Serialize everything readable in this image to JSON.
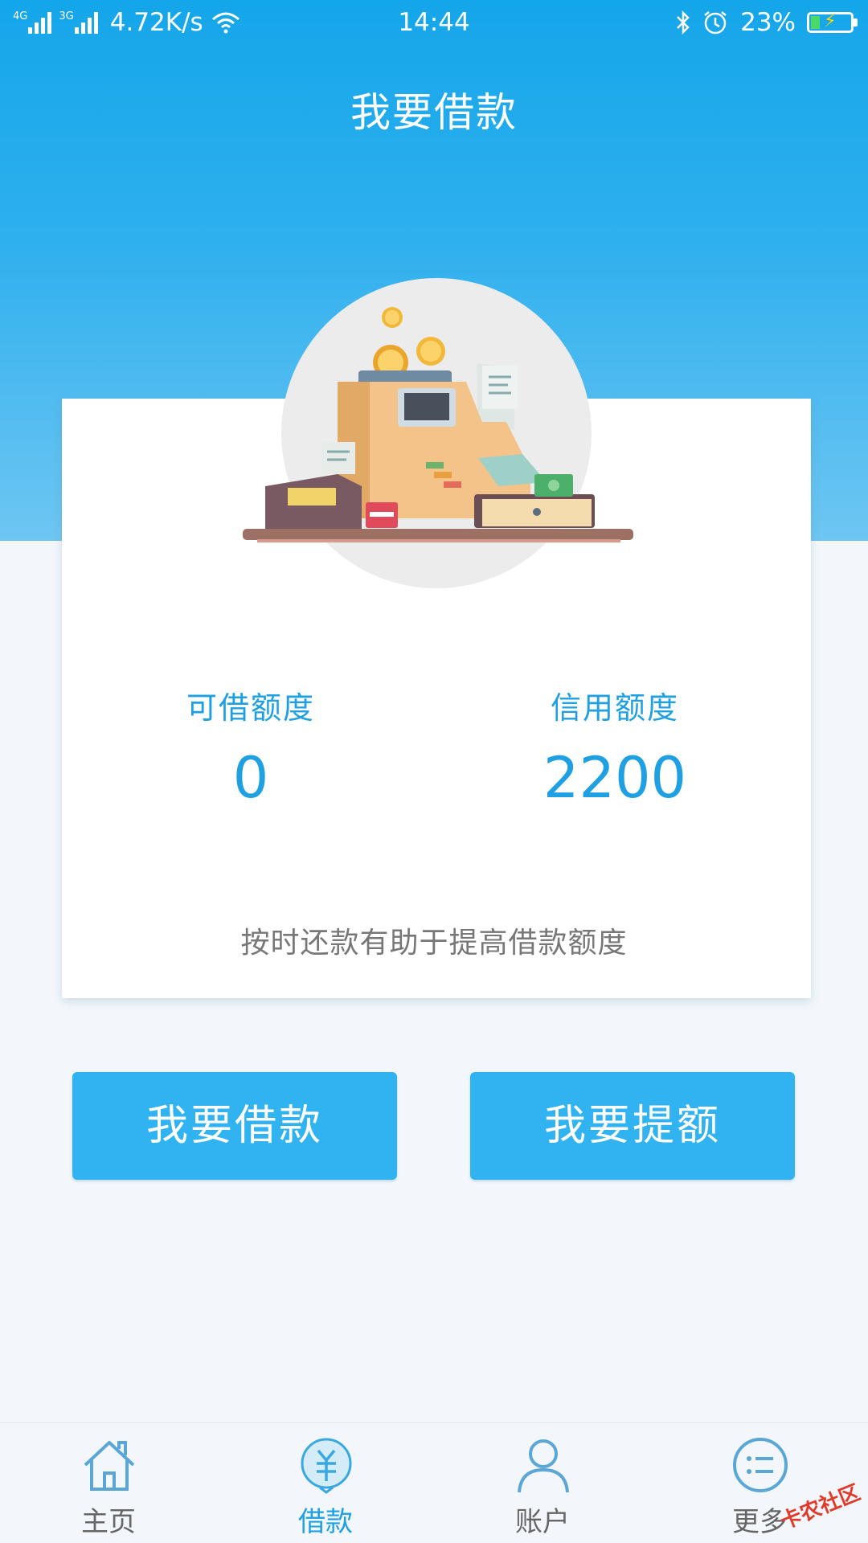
{
  "status_bar": {
    "net1": "4G",
    "net2": "3G",
    "speed": "4.72K/s",
    "time": "14:44",
    "battery": "23%",
    "battery_level": 0.23
  },
  "header": {
    "title": "我要借款"
  },
  "card": {
    "available": {
      "label": "可借额度",
      "value": "0"
    },
    "credit": {
      "label": "信用额度",
      "value": "2200"
    },
    "tip": "按时还款有助于提高借款额度"
  },
  "actions": {
    "borrow": "我要借款",
    "raise": "我要提额"
  },
  "tabbar": {
    "items": [
      {
        "label": "主页",
        "icon": "home-icon",
        "active": false
      },
      {
        "label": "借款",
        "icon": "yuan-loan-icon",
        "active": true
      },
      {
        "label": "账户",
        "icon": "user-icon",
        "active": false
      },
      {
        "label": "更多",
        "icon": "more-list-icon",
        "active": false
      }
    ]
  },
  "watermark": "卡农社区",
  "colors": {
    "primary": "#30b3f0",
    "accent_text": "#1ea0e3",
    "header_bg": "#14a6ea"
  }
}
